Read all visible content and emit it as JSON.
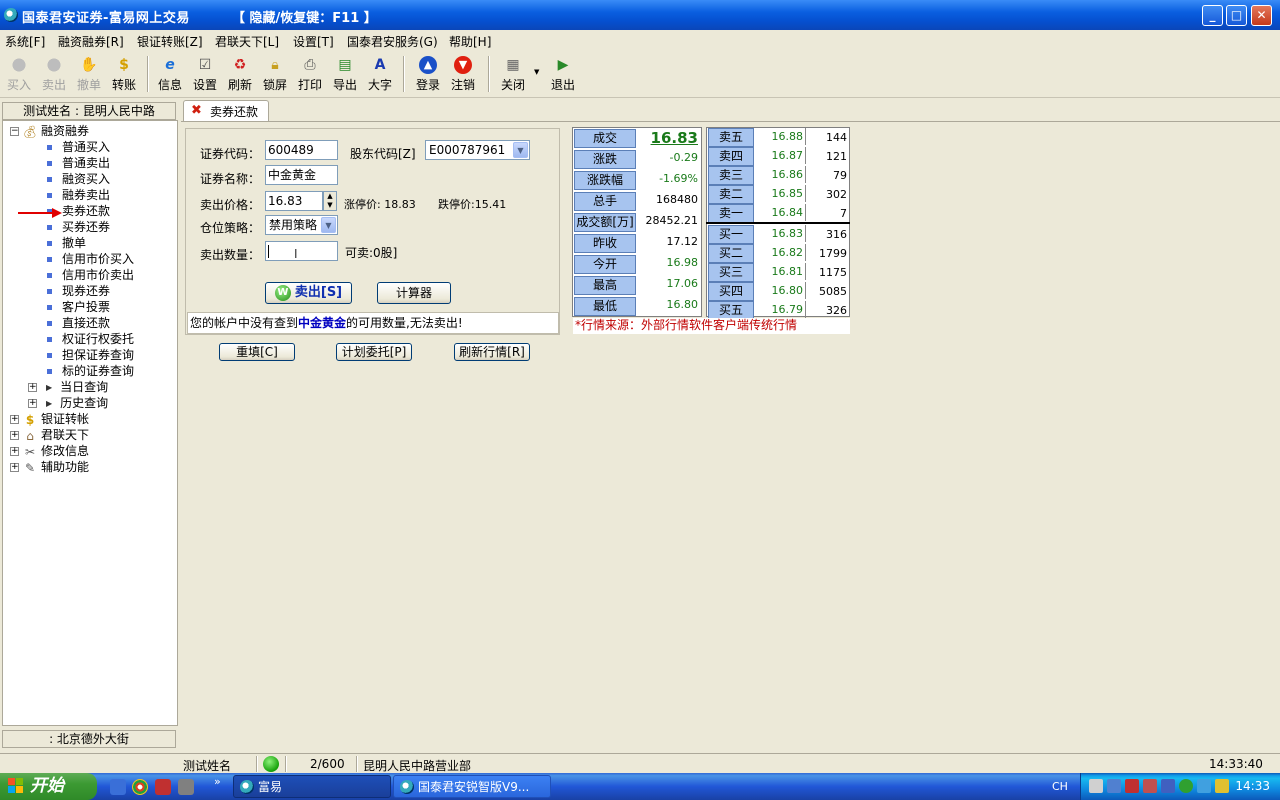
{
  "window": {
    "title": "国泰君安证券-富易网上交易",
    "hint": "【 隐藏/恢复键：F11 】"
  },
  "menu": [
    "系统[F]",
    "融资融券[R]",
    "银证转账[Z]",
    "君联天下[L]",
    "设置[T]",
    "国泰君安服务(G)",
    "帮助[H]"
  ],
  "toolbar": [
    {
      "label": "买入",
      "icon": "buy-icon",
      "enabled": false
    },
    {
      "label": "卖出",
      "icon": "sell-icon",
      "enabled": false
    },
    {
      "label": "撤单",
      "icon": "cancel-order-icon",
      "enabled": false
    },
    {
      "label": "转账",
      "icon": "dollar-icon",
      "enabled": true
    },
    {
      "label": "信息",
      "icon": "ie-icon",
      "enabled": true
    },
    {
      "label": "设置",
      "icon": "settings-icon",
      "enabled": true
    },
    {
      "label": "刷新",
      "icon": "refresh-icon",
      "enabled": true
    },
    {
      "label": "锁屏",
      "icon": "lock-icon",
      "enabled": true
    },
    {
      "label": "打印",
      "icon": "print-icon",
      "enabled": true
    },
    {
      "label": "导出",
      "icon": "export-icon",
      "enabled": true
    },
    {
      "label": "大字",
      "icon": "font-icon",
      "enabled": true
    },
    {
      "label": "登录",
      "icon": "login-icon",
      "enabled": true
    },
    {
      "label": "注销",
      "icon": "logout-icon",
      "enabled": true
    },
    {
      "label": "关闭",
      "icon": "close-doc-icon",
      "enabled": true
    },
    {
      "label": "退出",
      "icon": "exit-icon",
      "enabled": true
    }
  ],
  "left": {
    "header": "测试姓名 : 昆明人民中路",
    "footer": ": 北京德外大街",
    "tree": {
      "root": "融资融券",
      "children": [
        "普通买入",
        "普通卖出",
        "融资买入",
        "融券卖出",
        "卖券还款",
        "买券还券",
        "撤单",
        "信用市价买入",
        "信用市价卖出",
        "现券还券",
        "客户投票",
        "直接还款",
        "权证行权委托",
        "担保证券查询",
        "标的证券查询"
      ],
      "subfolders": [
        "当日查询",
        "历史查询"
      ],
      "others": [
        "银证转帐",
        "君联天下",
        "修改信息",
        "辅助功能"
      ]
    }
  },
  "tab": {
    "label": "卖券还款"
  },
  "form": {
    "code_label": "证券代码：",
    "code_value": "600489",
    "holder_label": "股东代码[Z]",
    "holder_value": "E000787961",
    "name_label": "证券名称：",
    "name_value": "中金黄金",
    "price_label": "卖出价格：",
    "price_value": "16.83",
    "limit_up": "涨停价:  18.83",
    "limit_down": "跌停价:15.41",
    "strategy_label": "仓位策略：",
    "strategy_value": "禁用策略",
    "qty_label": "卖出数量：",
    "qty_value": "",
    "available": "可卖:0股]",
    "sell_button": "卖出[S]",
    "calc_button": "计算器",
    "message_pre": "您的帐户中没有查到",
    "message_stock": "中金黄金",
    "message_post": "的可用数量,无法卖出!"
  },
  "quote": [
    {
      "label": "成交",
      "value": "16.83",
      "style": "big"
    },
    {
      "label": "涨跌",
      "value": "-0.29",
      "style": "green"
    },
    {
      "label": "涨跌幅",
      "value": "-1.69%",
      "style": "green"
    },
    {
      "label": "总手",
      "value": "168480",
      "style": ""
    },
    {
      "label": "成交额[万]",
      "value": "28452.21",
      "style": ""
    },
    {
      "label": "昨收",
      "value": "17.12",
      "style": ""
    },
    {
      "label": "今开",
      "value": "16.98",
      "style": "green"
    },
    {
      "label": "最高",
      "value": "17.06",
      "style": "green"
    },
    {
      "label": "最低",
      "value": "16.80",
      "style": "green"
    }
  ],
  "orderbook": [
    {
      "label": "卖五",
      "price": "16.88",
      "vol": "144"
    },
    {
      "label": "卖四",
      "price": "16.87",
      "vol": "121"
    },
    {
      "label": "卖三",
      "price": "16.86",
      "vol": "79"
    },
    {
      "label": "卖二",
      "price": "16.85",
      "vol": "302"
    },
    {
      "label": "卖一",
      "price": "16.84",
      "vol": "7"
    },
    {
      "label": "买一",
      "price": "16.83",
      "vol": "316"
    },
    {
      "label": "买二",
      "price": "16.82",
      "vol": "1799"
    },
    {
      "label": "买三",
      "price": "16.81",
      "vol": "1175"
    },
    {
      "label": "买四",
      "price": "16.80",
      "vol": "5085"
    },
    {
      "label": "买五",
      "price": "16.79",
      "vol": "326"
    }
  ],
  "quote_source": "*行情来源：外部行情软件客户端传统行情",
  "bottom_buttons": [
    "重填[C]",
    "计划委托[P]",
    "刷新行情[R]"
  ],
  "status": {
    "user": "测试姓名",
    "count": "2/600",
    "branch": "昆明人民中路营业部",
    "time": "14:33:40"
  },
  "taskbar": {
    "start": "开始",
    "tasks": [
      "富易",
      "国泰君安锐智版V9..."
    ],
    "ime": "CH",
    "clock": "14:33"
  },
  "colors": {
    "title_blue": "#0a5fe0",
    "quote_label_bg": "#a7c4ef",
    "down_green": "#1a7a1a",
    "source_red": "#c00000",
    "status_ok": "#16a10a"
  }
}
